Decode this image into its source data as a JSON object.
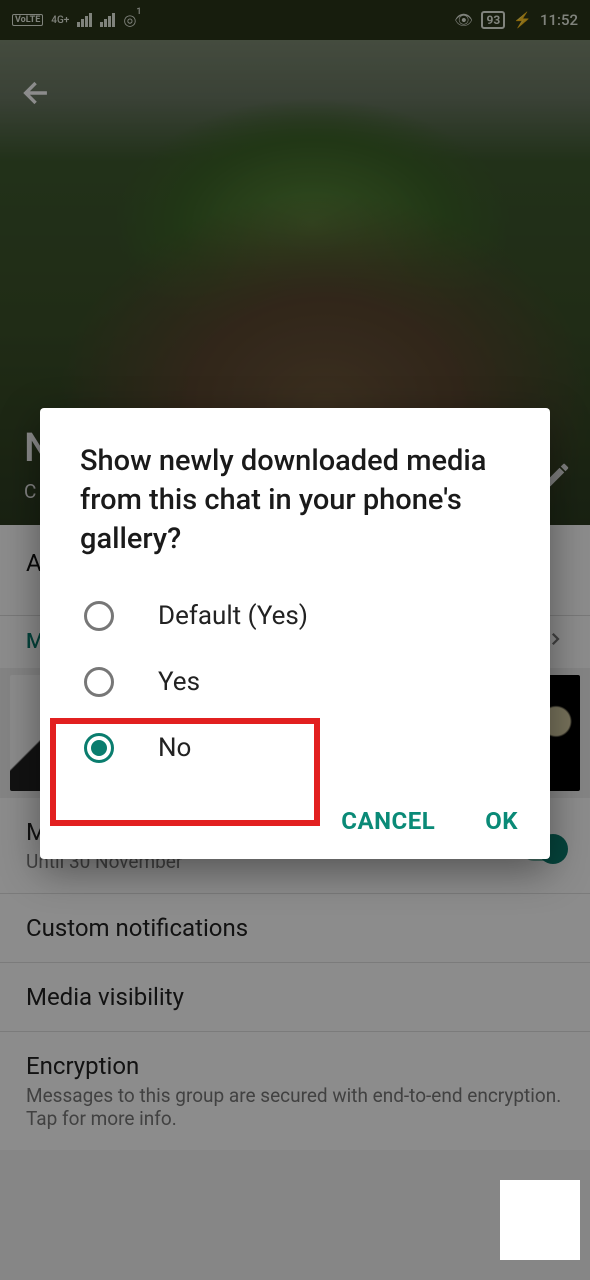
{
  "status": {
    "volte": "VoLTE",
    "net": "4G+",
    "hotspot_badge": "1",
    "battery": "93",
    "time": "11:52"
  },
  "header": {
    "title_initial": "N",
    "sub_initial": "C"
  },
  "sections": {
    "top_initial": "A",
    "media_label_initial": "M",
    "mute_title_initial": "M",
    "mute_sub": "Until 30 November",
    "custom_notifications": "Custom notifications",
    "media_visibility": "Media visibility",
    "encryption_title": "Encryption",
    "encryption_sub": "Messages to this group are secured with end-to-end encryption. Tap for more info."
  },
  "dialog": {
    "title": "Show newly downloaded media from this chat in your phone's gallery?",
    "options": [
      "Default (Yes)",
      "Yes",
      "No"
    ],
    "selected": "No",
    "cancel": "CANCEL",
    "ok": "OK"
  }
}
